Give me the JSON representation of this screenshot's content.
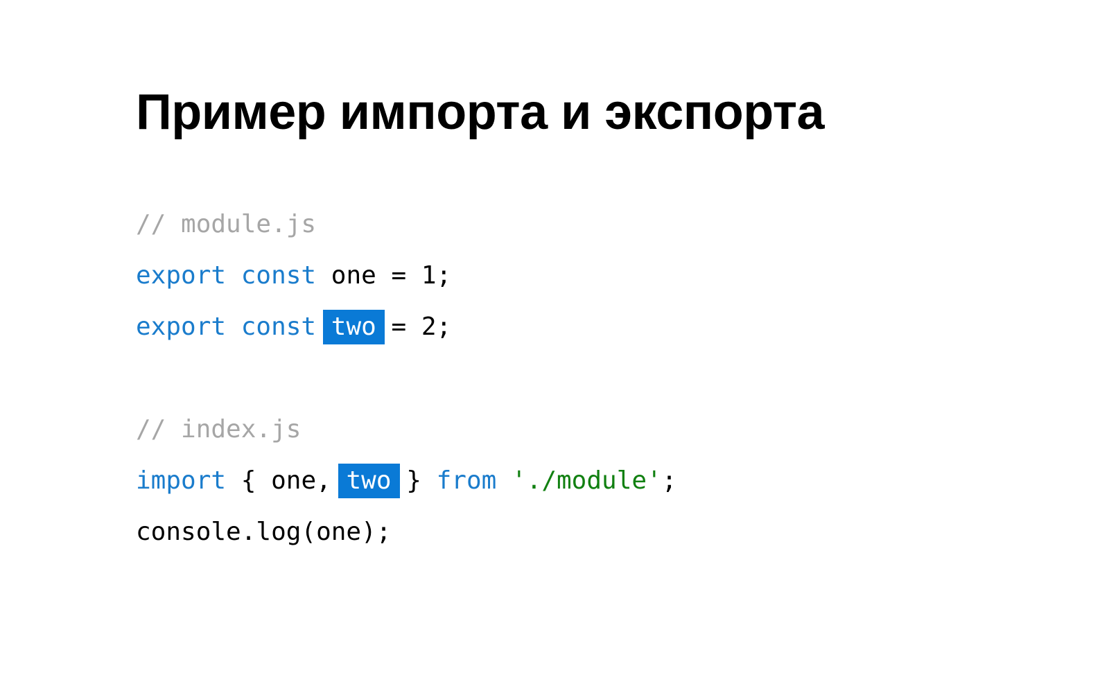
{
  "slide": {
    "title": "Пример импорта и экспорта"
  },
  "colors": {
    "comment": "#a6a6a6",
    "keyword": "#1a7ccc",
    "string": "#118011",
    "highlight_bg": "#0a7ad6",
    "text": "#000000"
  },
  "code": {
    "module_comment": "// module.js",
    "line1": {
      "kw_export": "export",
      "kw_const": "const",
      "name": "one",
      "rest": "= 1;"
    },
    "line2": {
      "kw_export": "export",
      "kw_const": "const",
      "name_highlighted": "two",
      "rest": "= 2;"
    },
    "index_comment": "// index.js",
    "line3": {
      "kw_import": "import",
      "open_brace": "{",
      "name_one": "one,",
      "name_highlighted": "two",
      "close_brace": "}",
      "kw_from": "from",
      "path": "'./module'",
      "semicolon": ";"
    },
    "line4": {
      "text": "console.log(one);"
    }
  }
}
